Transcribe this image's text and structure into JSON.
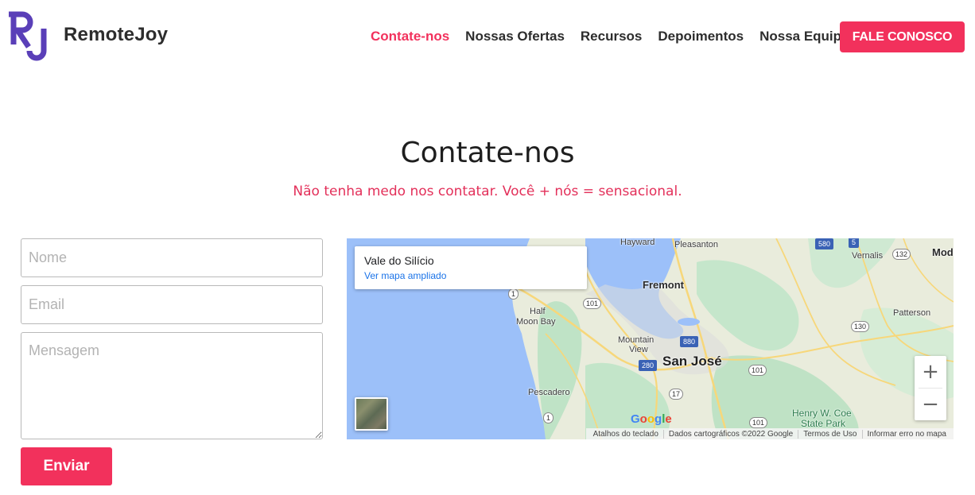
{
  "brand": {
    "name": "RemoteJoy",
    "logo_letters": "RJ",
    "logo_color": "#5a3fb8"
  },
  "nav": {
    "items": [
      {
        "label": "Contate-nos",
        "active": true
      },
      {
        "label": "Nossas Ofertas",
        "active": false
      },
      {
        "label": "Recursos",
        "active": false
      },
      {
        "label": "Depoimentos",
        "active": false
      },
      {
        "label": "Nossa Equipe",
        "active": false
      }
    ],
    "cta_label": "FALE CONOSCO"
  },
  "colors": {
    "accent": "#f2315c",
    "text": "#2d2d2d",
    "subtitle": "#e3305a"
  },
  "hero": {
    "title": "Contate-nos",
    "subtitle": "Não tenha medo nos contatar. Você + nós = sensacional."
  },
  "form": {
    "name_placeholder": "Nome",
    "email_placeholder": "Email",
    "message_placeholder": "Mensagem",
    "submit_label": "Enviar"
  },
  "map": {
    "info_title": "Vale do Silício",
    "info_link": "Ver mapa ampliado",
    "zoom_in": "+",
    "zoom_out": "−",
    "google": [
      "G",
      "o",
      "o",
      "g",
      "l",
      "e"
    ],
    "places": {
      "hayward": "Hayward",
      "pleasanton": "Pleasanton",
      "vernalis": "Vernalis",
      "mod": "Mod",
      "fremont": "Fremont",
      "half": "Half",
      "moon_bay": "Moon Bay",
      "patterson": "Patterson",
      "mountain": "Mountain",
      "view": "View",
      "san_jose": "San José",
      "pescadero": "Pescadero",
      "henry": "Henry W. Coe",
      "state_park": "State Park"
    },
    "shields": {
      "s580": "580",
      "s5": "5",
      "s132": "132",
      "s1a": "1",
      "s101a": "101",
      "s130": "130",
      "s880": "880",
      "s280": "280",
      "s101b": "101",
      "s17": "17",
      "s1b": "1",
      "s101c": "101"
    },
    "attribution": [
      "Atalhos do teclado",
      "Dados cartográficos ©2022 Google",
      "Termos de Uso",
      "Informar erro no mapa"
    ]
  }
}
